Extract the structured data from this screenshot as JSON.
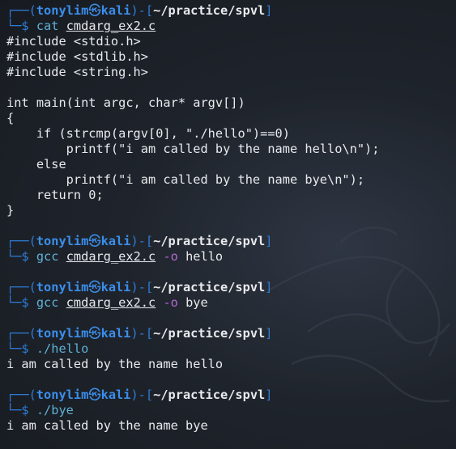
{
  "prompt": {
    "box_top": "┌──(",
    "user": "tonylim",
    "at_symbol": "㉿",
    "host": "kali",
    "mid": ")-[",
    "path": "~/practice/spvl",
    "end": "]",
    "box_bottom": "└─$ "
  },
  "blocks": [
    {
      "command": {
        "name": "cat",
        "arg": "cmdarg_ex2.c",
        "flag": "",
        "rest": ""
      },
      "output": [
        "#include <stdio.h>",
        "#include <stdlib.h>",
        "#include <string.h>",
        "",
        "int main(int argc, char* argv[])",
        "{",
        "    if (strcmp(argv[0], \"./hello\")==0)",
        "        printf(\"i am called by the name hello\\n\");",
        "    else",
        "        printf(\"i am called by the name bye\\n\");",
        "    return 0;",
        "}"
      ]
    },
    {
      "command": {
        "name": "gcc",
        "arg": "cmdarg_ex2.c",
        "flag": "-o",
        "rest": "hello"
      },
      "output": []
    },
    {
      "command": {
        "name": "gcc",
        "arg": "cmdarg_ex2.c",
        "flag": "-o",
        "rest": "bye"
      },
      "output": []
    },
    {
      "command": {
        "name": "./hello",
        "arg": "",
        "flag": "",
        "rest": ""
      },
      "output": [
        "i am called by the name hello"
      ]
    },
    {
      "command": {
        "name": "./bye",
        "arg": "",
        "flag": "",
        "rest": ""
      },
      "output": [
        "i am called by the name bye"
      ]
    }
  ]
}
